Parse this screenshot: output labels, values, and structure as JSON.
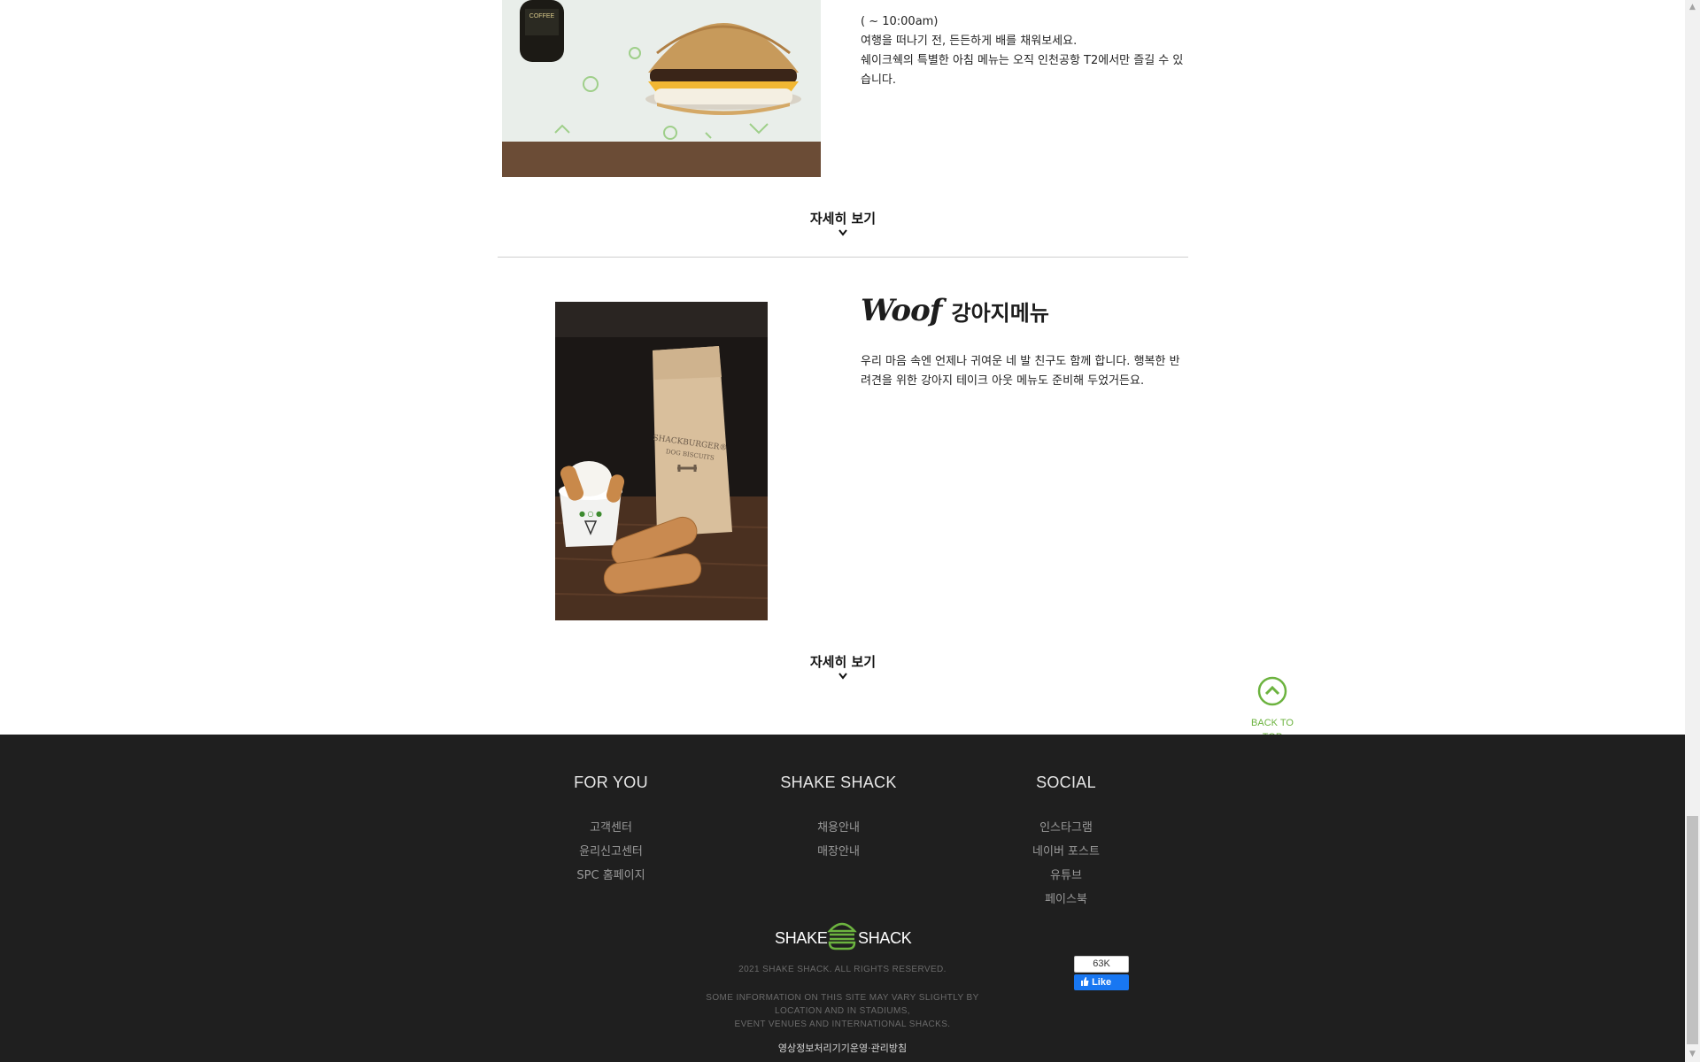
{
  "breakfast": {
    "lines": [
      "( ~ 10:00am)",
      "여행을 떠나기 전, 든든하게 배를 채워보세요.",
      "쉐이크쉑의 특별한 아침 메뉴는 오직 인천공항 T2에서만 즐길 수 있습니다."
    ],
    "more_label": "자세히 보기",
    "photo_label": "COFFEE"
  },
  "woof": {
    "title_word": "Woof",
    "title_ko": "강아지메뉴",
    "text": "우리 마음 속엔 언제나 귀여운 네 발 친구도 함께 합니다. 행복한 반려견을 위한 강아지 테이크 아웃 메뉴도 준비해 두었거든요.",
    "more_label": "자세히 보기",
    "bag_line1": "SHACKBURGER®",
    "bag_line2": "DOG BISCUITS"
  },
  "back_to_top": {
    "label_line1": "BACK TO",
    "label_line2": "TOP"
  },
  "footer": {
    "columns": [
      {
        "title": "FOR YOU",
        "items": [
          "고객센터",
          "윤리신고센터",
          "SPC 홈페이지"
        ]
      },
      {
        "title": "SHAKE SHACK",
        "items": [
          "채용안내",
          "매장안내"
        ]
      },
      {
        "title": "SOCIAL",
        "items": [
          "인스타그램",
          "네이버 포스트",
          "유튜브",
          "페이스북"
        ]
      }
    ],
    "logo_left": "SHAKE",
    "logo_right": "SHACK",
    "copyright": "2021 SHAKE SHACK. ALL RIGHTS RESERVED.",
    "disclaimer_lines": [
      "SOME INFORMATION ON THIS SITE MAY VARY SLIGHTLY BY",
      "LOCATION AND IN STADIUMS,",
      "EVENT VENUES AND INTERNATIONAL SHACKS."
    ],
    "policy_link": "영상정보처리기기운영·관리방침"
  },
  "fb": {
    "count": "63K",
    "button_label": "Like"
  },
  "colors": {
    "accent_green": "#6cb33f",
    "footer_bg": "#1f1f1f",
    "fb_blue": "#1877f2"
  }
}
